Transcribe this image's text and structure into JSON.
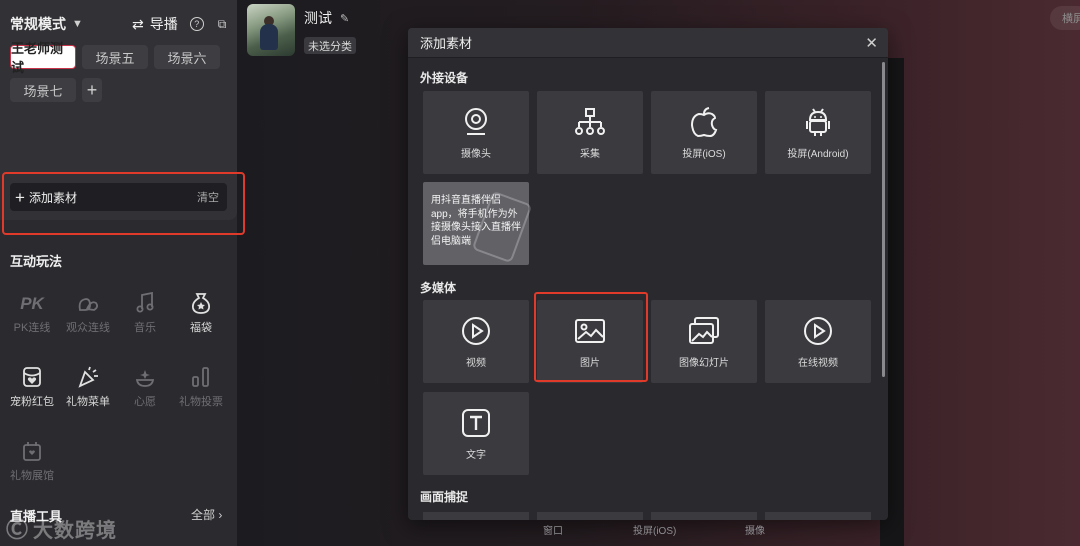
{
  "sidebar": {
    "mode_label": "常规模式",
    "guide_label": "导播",
    "scenes": [
      {
        "label": "王老师测试",
        "active": true
      },
      {
        "label": "场景五",
        "active": false
      },
      {
        "label": "场景六",
        "active": false
      },
      {
        "label": "场景七",
        "active": false
      }
    ],
    "add_material_label": "添加素材",
    "clear_label": "清空",
    "interactive_title": "互动玩法",
    "tools": [
      {
        "label": "PK连线",
        "icon": "pk-icon",
        "enabled": false
      },
      {
        "label": "观众连线",
        "icon": "audience-link-icon",
        "enabled": false
      },
      {
        "label": "音乐",
        "icon": "music-icon",
        "enabled": false
      },
      {
        "label": "福袋",
        "icon": "lucky-bag-icon",
        "enabled": true
      },
      {
        "label": "宠粉红包",
        "icon": "red-packet-icon",
        "enabled": true
      },
      {
        "label": "礼物菜单",
        "icon": "gift-menu-icon",
        "enabled": true
      },
      {
        "label": "心愿",
        "icon": "wish-icon",
        "enabled": false
      },
      {
        "label": "礼物投票",
        "icon": "gift-vote-icon",
        "enabled": false
      },
      {
        "label": "礼物展馆",
        "icon": "gift-gallery-icon",
        "enabled": false
      }
    ],
    "live_tools_title": "直播工具",
    "all_link": "全部",
    "watermark": "大数跨境"
  },
  "header": {
    "user_name": "测试",
    "category": "未选分类",
    "right_pill": "横屏"
  },
  "dialog": {
    "title": "添加素材",
    "sections": [
      {
        "title": "外接设备"
      },
      {
        "title": "多媒体"
      },
      {
        "title": "画面捕捉"
      }
    ],
    "external": [
      {
        "label": "摄像头",
        "icon": "camera-icon"
      },
      {
        "label": "采集",
        "icon": "capture-tree-icon"
      },
      {
        "label": "投屏(iOS)",
        "icon": "apple-icon"
      },
      {
        "label": "投屏(Android)",
        "icon": "android-icon"
      }
    ],
    "tip_text": "用抖音直播伴侣app，将手机作为外接摄像头接入直播伴侣电脑端",
    "media": [
      {
        "label": "视频",
        "icon": "play-icon"
      },
      {
        "label": "图片",
        "icon": "image-icon"
      },
      {
        "label": "图像幻灯片",
        "icon": "slideshow-icon"
      },
      {
        "label": "在线视频",
        "icon": "online-video-icon"
      },
      {
        "label": "文字",
        "icon": "text-icon"
      }
    ],
    "capture_peek": [
      "窗口",
      "投屏(iOS)",
      "摄像"
    ]
  },
  "colors": {
    "highlight": "#e03a2a",
    "active_scene_border": "#c8344a"
  }
}
